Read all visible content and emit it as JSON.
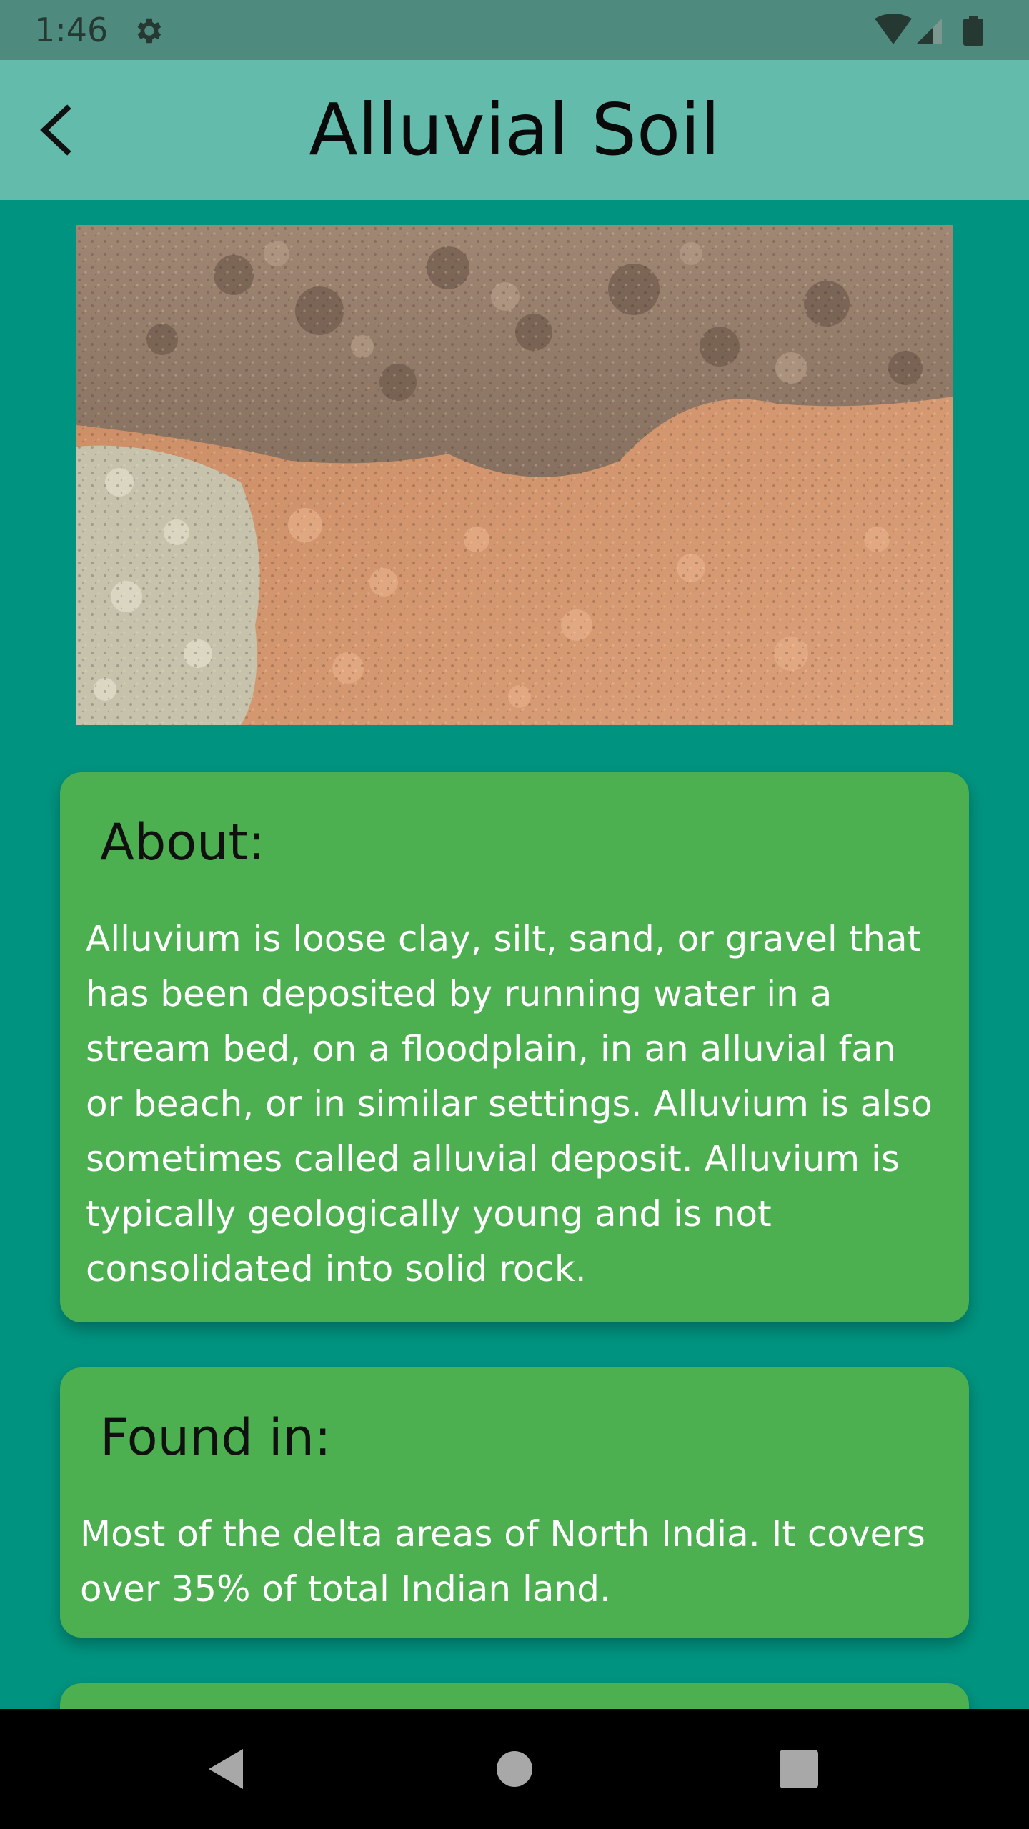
{
  "status_bar": {
    "time": "1:46",
    "icons": [
      "gear-icon",
      "wifi-icon",
      "cell-signal-icon",
      "battery-icon"
    ]
  },
  "app_bar": {
    "title": "Alluvial Soil",
    "back_icon": "chevron-left-icon"
  },
  "hero_image": {
    "subject": "alluvial-soil-layers"
  },
  "about": {
    "heading": "About:",
    "body_lines": [
      "Alluvium is loose clay, silt, sand, or gravel that",
      "has been deposited by running water in a",
      "stream bed, on a floodplain, in an alluvial fan",
      "or beach, or in similar settings. Alluvium is also",
      "sometimes called alluvial deposit. Alluvium is",
      "typically geologically young and is not",
      "consolidated into solid rock."
    ]
  },
  "found_in": {
    "heading": "Found in:",
    "body_lines": [
      "Most of the delta areas of North India. It covers",
      "over 35% of total Indian land."
    ]
  },
  "nav_bar": {
    "icons": [
      "nav-back-icon",
      "nav-home-icon",
      "nav-recent-icon"
    ]
  },
  "colors": {
    "background": "#009480",
    "app_bar": "#63bbab",
    "status_bar": "#4f8a7f",
    "card": "#4caf50"
  }
}
